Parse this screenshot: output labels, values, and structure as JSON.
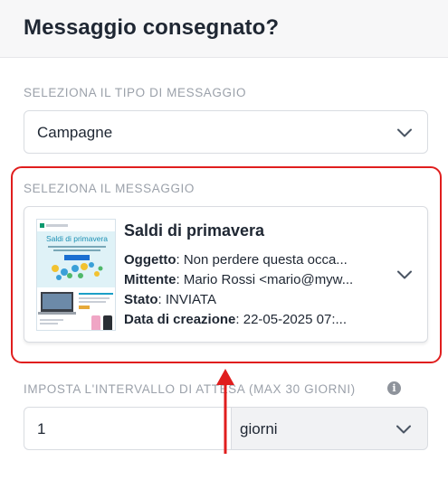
{
  "header": {
    "title": "Messaggio consegnato?"
  },
  "message_type": {
    "label": "SELEZIONA IL TIPO DI MESSAGGIO",
    "value": "Campagne"
  },
  "message_select": {
    "label": "SELEZIONA IL MESSAGGIO",
    "card": {
      "title": "Saldi di primavera",
      "subject_key": "Oggetto",
      "subject_value": "Non perdere questa occa...",
      "sender_key": "Mittente",
      "sender_value": "Mario Rossi <mario@myw...",
      "status_key": "Stato",
      "status_value": "INVIATA",
      "created_key": "Data di creazione",
      "created_value": "22-05-2025 07:..."
    },
    "thumbnail": {
      "brand": "Brevo",
      "title": "Saldi di primavera",
      "cta": "Scopri"
    }
  },
  "wait_interval": {
    "label": "IMPOSTA L'INTERVALLO DI ATTESA (MAX 30 GIORNI)",
    "value": "1",
    "unit": "giorni"
  },
  "colors": {
    "highlight": "#e01e1e",
    "text": "#1f2733",
    "label": "#9ba1aa"
  }
}
